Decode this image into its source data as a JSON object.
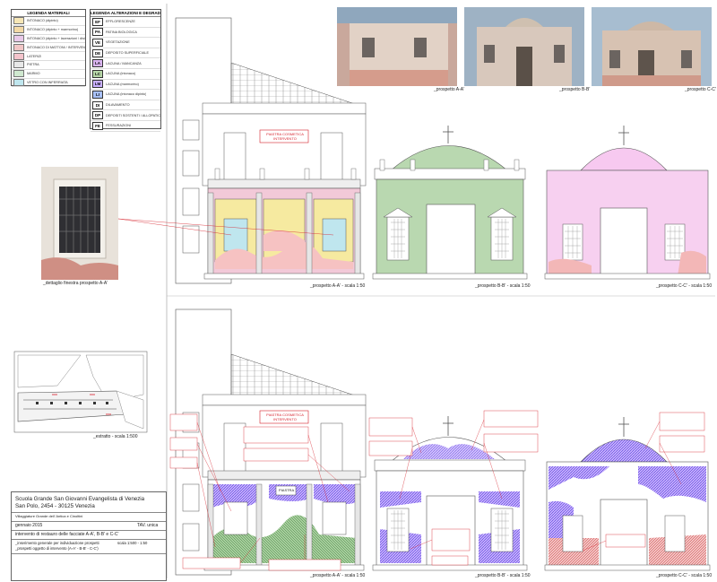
{
  "legend_materials": {
    "title": "LEGENDA MATERIALI",
    "items": [
      {
        "label": "INTONACO (dipinto)",
        "color": "#f6e6b6"
      },
      {
        "label": "INTONACO (dipinto + marmorino)",
        "color": "#f3d9a6"
      },
      {
        "label": "INTONACO (dipinto + lacerazioni / disintonacatura)",
        "color": "#e9c9e9"
      },
      {
        "label": "INTONACO DI MATTONI / INTERVENTO",
        "color": "#f1c6c6"
      },
      {
        "label": "LATERIZI",
        "color": "#f4c4cc"
      },
      {
        "label": "PIETRA",
        "color": "#e8e8e8"
      },
      {
        "label": "MARMO",
        "color": "#cfe8cf"
      },
      {
        "label": "VETRO CON INFERRIATA",
        "color": "#bfe6ee"
      }
    ]
  },
  "legend_degradation": {
    "title": "LEGENDA ALTERAZIONI E DEGRADAZIONI",
    "items": [
      {
        "code": "EF",
        "label": "EFFLORESCENZE",
        "color": "#ffffff"
      },
      {
        "code": "PA",
        "label": "PATINA BIOLOGICA",
        "color": "#ffffff"
      },
      {
        "code": "VE",
        "label": "VEGETAZIONE",
        "color": "#ffffff"
      },
      {
        "code": "DE",
        "label": "DEPOSITO SUPERFICIALE",
        "color": "#ffffff"
      },
      {
        "code": "LA",
        "label": "LACUNA / MANCANZA",
        "color": "#d9b4ef"
      },
      {
        "code": "LC",
        "label": "LACUNA (intonaco)",
        "color": "#b7d7a8"
      },
      {
        "code": "LM",
        "label": "LACUNA (marmorino)",
        "color": "#c9b0ff"
      },
      {
        "code": "LI",
        "label": "LACUNA (intonaco dipinto)",
        "color": "#a8c0f5"
      },
      {
        "code": "DI",
        "label": "DILAVAMENTO",
        "color": "#ffffff"
      },
      {
        "code": "DP",
        "label": "DEPOSITI SOSTENTI / ALLOPATICI",
        "color": "#ffffff"
      },
      {
        "code": "FE",
        "label": "FESSURAZIONI",
        "color": "#ffffff"
      }
    ]
  },
  "photos": {
    "cap_a": "_prospetto A-A'",
    "cap_b": "_prospetto B-B'",
    "cap_c": "_prospetto C-C'",
    "detail_cap": "_dettaglio finestra prospetto A-A'"
  },
  "elevations": {
    "top_a": "_prospetto A-A' - scala 1:50",
    "top_b": "_prospetto B-B' - scala 1:50",
    "top_c": "_prospetto C-C' - scala 1:50",
    "bot_a": "_prospetto A-A' - scala 1:50",
    "bot_b": "_prospetto B-B' - scala 1:50",
    "bot_c": "_prospetto C-C' - scala 1:50",
    "red_label": "PIASTRA COSMETICA INTERVENTO",
    "inner_label": "PIASTRA"
  },
  "site": {
    "cap": "_estratto - scala 1:500"
  },
  "title_block": {
    "name_line1": "Scuola Grande San Giovanni Evangelista di Venezia",
    "name_line2": "San Polo, 2454 - 30125 Venezia",
    "sub": "Villaggiature Grande dell' Antica e Cinoltini",
    "date": "gennaio 2015",
    "tav": "TAV. unica",
    "intervention": "intervento di restauro delle facciate A-A', B-B' e C-C'",
    "desc1": "_inserimento generale per individuazione prospetti",
    "desc2": "_prospetti oggetto di intervento (A-A' - B-B' - C-C')",
    "scale": "scala 1:500 - 1:50"
  },
  "colors": {
    "line": "#555555",
    "red": "#d61f2a",
    "pink": "#f2c9d8",
    "yellow": "#f6eaa0",
    "green": "#b9d8b0",
    "blue": "#8fa8ff",
    "sky": "#bfe6ee"
  }
}
